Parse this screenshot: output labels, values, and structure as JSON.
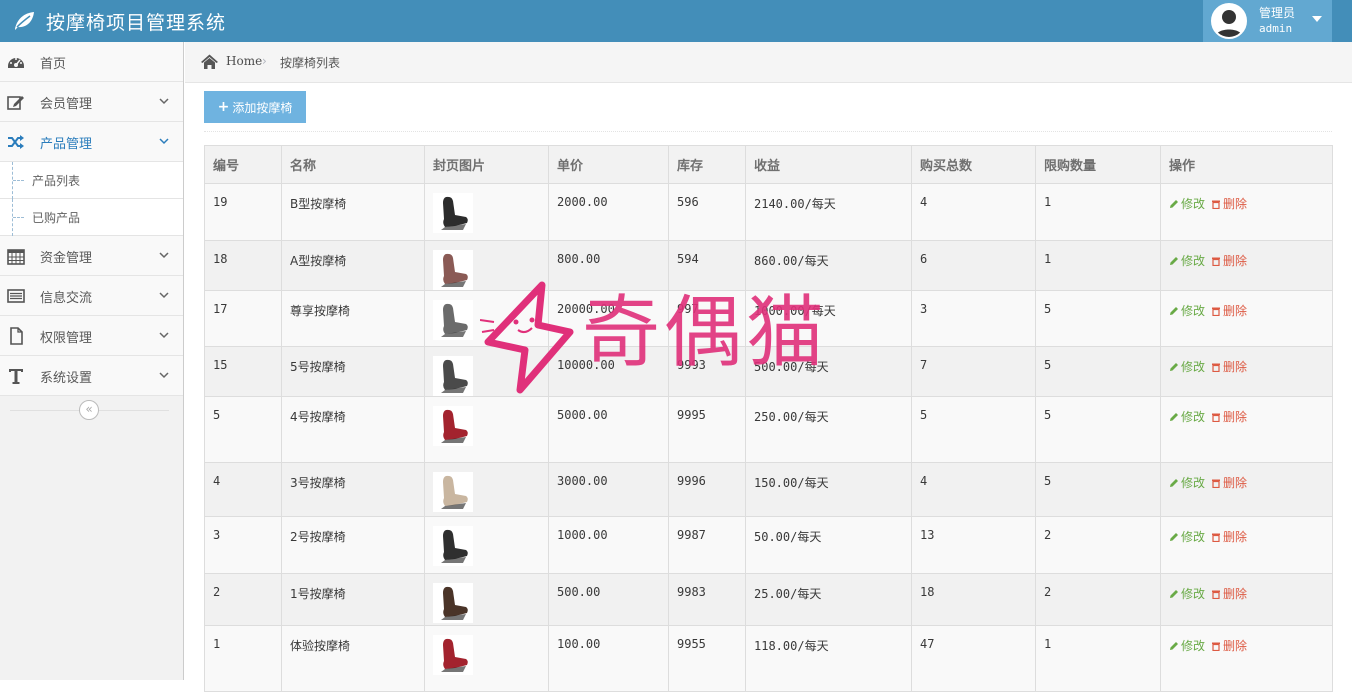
{
  "app": {
    "title": "按摩椅项目管理系统"
  },
  "user": {
    "role": "管理员",
    "name": "admin"
  },
  "sidebar": {
    "items": [
      {
        "label": "首页",
        "icon": "dashboard-icon",
        "expandable": false
      },
      {
        "label": "会员管理",
        "icon": "edit-icon",
        "expandable": true
      },
      {
        "label": "产品管理",
        "icon": "shuffle-icon",
        "expandable": true,
        "active": true,
        "children": [
          "产品列表",
          "已购产品"
        ]
      },
      {
        "label": "资金管理",
        "icon": "calendar-icon",
        "expandable": true
      },
      {
        "label": "信息交流",
        "icon": "list-icon",
        "expandable": true
      },
      {
        "label": "权限管理",
        "icon": "file-icon",
        "expandable": true
      },
      {
        "label": "系统设置",
        "icon": "text-icon",
        "expandable": true
      }
    ]
  },
  "breadcrumb": {
    "home": "Home",
    "current": "按摩椅列表"
  },
  "toolbar": {
    "add_label": "添加按摩椅"
  },
  "table": {
    "columns": [
      "编号",
      "名称",
      "封页图片",
      "单价",
      "库存",
      "收益",
      "购买总数",
      "限购数量",
      "操作"
    ],
    "edit_label": "修改",
    "delete_label": "删除",
    "rows": [
      {
        "id": "19",
        "name": "B型按摩椅",
        "thumb": "#2c2c2c",
        "price": "2000.00",
        "stock": "596",
        "income": "2140.00/每天",
        "bought": "4",
        "limit": "1"
      },
      {
        "id": "18",
        "name": "A型按摩椅",
        "thumb": "#8a5a55",
        "price": "800.00",
        "stock": "594",
        "income": "860.00/每天",
        "bought": "6",
        "limit": "1"
      },
      {
        "id": "17",
        "name": "尊享按摩椅",
        "thumb": "#6b6b6b",
        "price": "20000.00",
        "stock": "997",
        "income": "1000.00/每天",
        "bought": "3",
        "limit": "5"
      },
      {
        "id": "15",
        "name": "5号按摩椅",
        "thumb": "#4a4a4a",
        "price": "10000.00",
        "stock": "9993",
        "income": "500.00/每天",
        "bought": "7",
        "limit": "5"
      },
      {
        "id": "5",
        "name": "4号按摩椅",
        "thumb": "#a3232e",
        "price": "5000.00",
        "stock": "9995",
        "income": "250.00/每天",
        "bought": "5",
        "limit": "5"
      },
      {
        "id": "4",
        "name": "3号按摩椅",
        "thumb": "#c9b6a0",
        "price": "3000.00",
        "stock": "9996",
        "income": "150.00/每天",
        "bought": "4",
        "limit": "5"
      },
      {
        "id": "3",
        "name": "2号按摩椅",
        "thumb": "#2f2f2f",
        "price": "1000.00",
        "stock": "9987",
        "income": "50.00/每天",
        "bought": "13",
        "limit": "2"
      },
      {
        "id": "2",
        "name": "1号按摩椅",
        "thumb": "#4a3428",
        "price": "500.00",
        "stock": "9983",
        "income": "25.00/每天",
        "bought": "18",
        "limit": "2"
      },
      {
        "id": "1",
        "name": "体验按摩椅",
        "thumb": "#a3232e",
        "price": "100.00",
        "stock": "9955",
        "income": "118.00/每天",
        "bought": "47",
        "limit": "1"
      }
    ]
  },
  "watermark": {
    "text": "奇偶猫",
    "color": "#e0307a"
  }
}
